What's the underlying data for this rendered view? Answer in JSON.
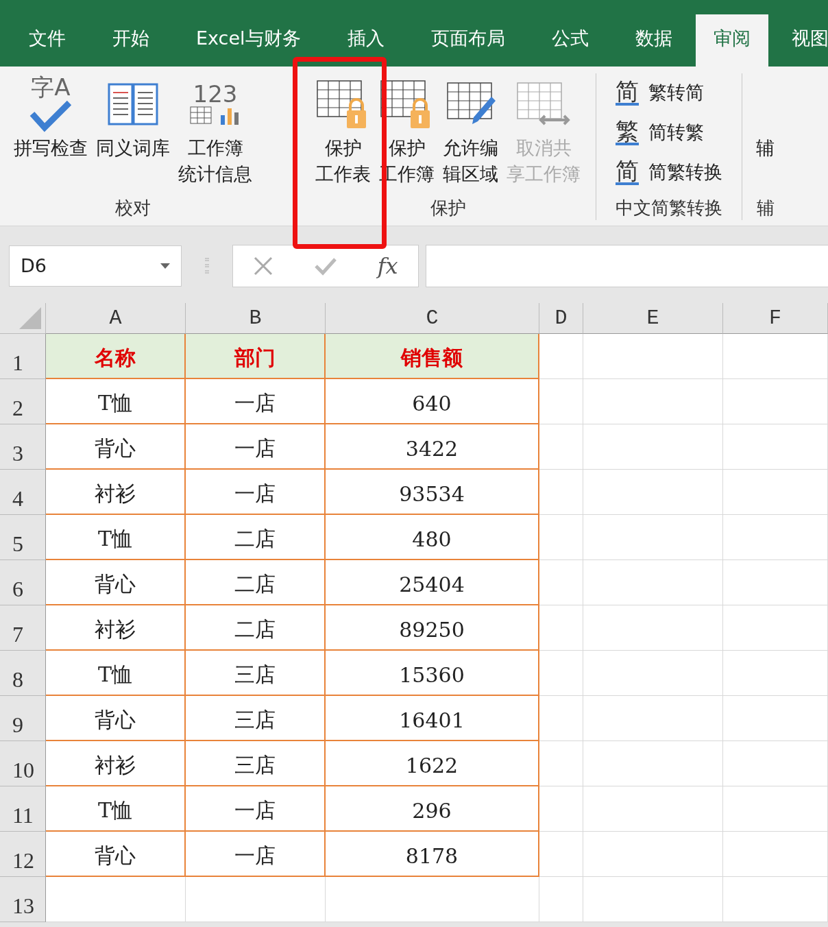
{
  "tabs": [
    {
      "label": "文件",
      "selected": false
    },
    {
      "label": "开始",
      "selected": false
    },
    {
      "label": "Excel与财务",
      "selected": false
    },
    {
      "label": "插入",
      "selected": false
    },
    {
      "label": "页面布局",
      "selected": false
    },
    {
      "label": "公式",
      "selected": false
    },
    {
      "label": "数据",
      "selected": false
    },
    {
      "label": "审阅",
      "selected": true
    },
    {
      "label": "视图",
      "selected": false
    }
  ],
  "ribbon": {
    "groups": [
      {
        "label": "校对",
        "items": [
          {
            "kind": "large",
            "lines": [
              "拼写检查"
            ],
            "glyph": "字A",
            "disabled": false
          },
          {
            "kind": "large",
            "lines": [
              "同义词库"
            ],
            "disabled": false
          },
          {
            "kind": "large",
            "lines": [
              "工作簿",
              "统计信息"
            ],
            "glyph": "123",
            "disabled": false
          }
        ]
      },
      {
        "label": "保护",
        "items": [
          {
            "kind": "large",
            "lines": [
              "保护",
              "工作表"
            ],
            "disabled": false
          },
          {
            "kind": "large",
            "lines": [
              "保护",
              "工作簿"
            ],
            "disabled": false
          },
          {
            "kind": "large",
            "lines": [
              "允许编",
              "辑区域"
            ],
            "disabled": false
          },
          {
            "kind": "large",
            "lines": [
              "取消共",
              "享工作簿"
            ],
            "disabled": true
          }
        ]
      },
      {
        "label": "中文简繁转换",
        "items": [
          {
            "kind": "small",
            "lines": [
              "繁转简"
            ],
            "glyph": "简",
            "disabled": false
          },
          {
            "kind": "small",
            "lines": [
              "简转繁"
            ],
            "glyph": "繁",
            "disabled": false
          },
          {
            "kind": "small",
            "lines": [
              "简繁转换"
            ],
            "glyph": "简",
            "disabled": false
          }
        ]
      },
      {
        "label": "辅",
        "items": [
          {
            "kind": "text",
            "lines": [
              "辅"
            ]
          }
        ]
      }
    ]
  },
  "formula_bar": {
    "name_box": "D6",
    "function_button": "fx"
  },
  "sheet": {
    "columns": [
      "A",
      "B",
      "C",
      "D",
      "E",
      "F"
    ],
    "rows": [
      {
        "number": "1",
        "kind": "header",
        "cells": [
          "名称",
          "部门",
          "销售额"
        ]
      },
      {
        "number": "2",
        "kind": "data",
        "cells": [
          "T恤",
          "一店",
          "640"
        ]
      },
      {
        "number": "3",
        "kind": "data",
        "cells": [
          "背心",
          "一店",
          "3422"
        ]
      },
      {
        "number": "4",
        "kind": "data",
        "cells": [
          "衬衫",
          "一店",
          "93534"
        ]
      },
      {
        "number": "5",
        "kind": "data",
        "cells": [
          "T恤",
          "二店",
          "480"
        ]
      },
      {
        "number": "6",
        "kind": "data",
        "cells": [
          "背心",
          "二店",
          "25404"
        ]
      },
      {
        "number": "7",
        "kind": "data",
        "cells": [
          "衬衫",
          "二店",
          "89250"
        ]
      },
      {
        "number": "8",
        "kind": "data",
        "cells": [
          "T恤",
          "三店",
          "15360"
        ]
      },
      {
        "number": "9",
        "kind": "data",
        "cells": [
          "背心",
          "三店",
          "16401"
        ]
      },
      {
        "number": "10",
        "kind": "data",
        "cells": [
          "衬衫",
          "三店",
          "1622"
        ]
      },
      {
        "number": "11",
        "kind": "data",
        "cells": [
          "T恤",
          "一店",
          "296"
        ]
      },
      {
        "number": "12",
        "kind": "data",
        "cells": [
          "背心",
          "一店",
          "8178"
        ]
      },
      {
        "number": "13",
        "kind": "empty"
      }
    ]
  }
}
